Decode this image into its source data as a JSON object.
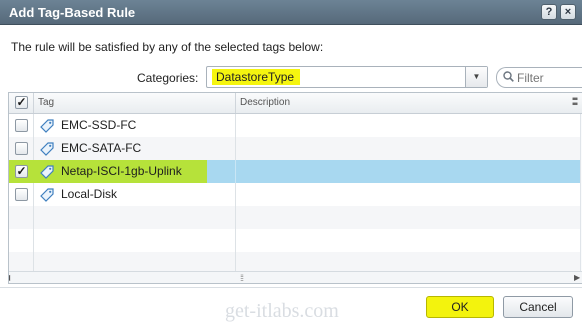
{
  "dialog": {
    "title": "Add Tag-Based Rule",
    "help_label": "?",
    "close_label": "×"
  },
  "instructions": "The rule will be satisfied by any of the selected tags below:",
  "categories": {
    "label": "Categories:",
    "selected": "DatastoreType"
  },
  "filter": {
    "placeholder": "Filter"
  },
  "grid": {
    "columns": {
      "tag": "Tag",
      "description": "Description"
    },
    "header_checked": true,
    "rows": [
      {
        "tag": "EMC-SSD-FC",
        "description": "",
        "checked": false
      },
      {
        "tag": "EMC-SATA-FC",
        "description": "",
        "checked": false
      },
      {
        "tag": "Netap-ISCI-1gb-Uplink",
        "description": "",
        "checked": true
      },
      {
        "tag": "Local-Disk",
        "description": "",
        "checked": false
      }
    ]
  },
  "watermark": "get-itlabs.com",
  "buttons": {
    "ok": "OK",
    "cancel": "Cancel"
  },
  "colors": {
    "highlight_yellow": "#f5f50f",
    "highlight_green": "#b6e23a",
    "selected_row": "#a8d8f0",
    "titlebar": "#5f7485"
  },
  "icons": [
    "help-icon",
    "close-icon",
    "dropdown-arrow-icon",
    "search-icon",
    "tag-icon",
    "checkmark-icon",
    "column-menu-icon",
    "scroll-left-icon",
    "scroll-right-icon"
  ]
}
